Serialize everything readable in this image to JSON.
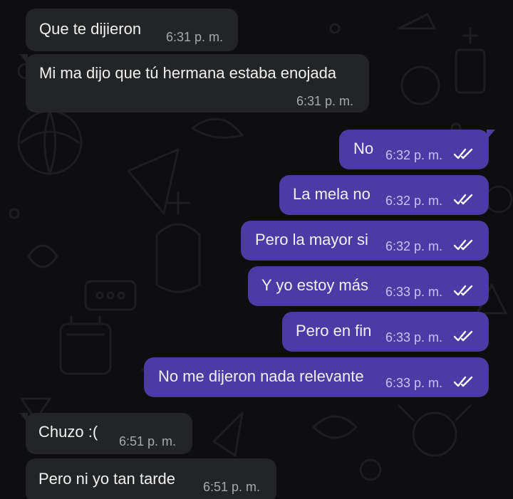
{
  "messages": [
    {
      "id": "m1",
      "direction": "in",
      "text": "Que te dijieron",
      "time": "6:31 p. m."
    },
    {
      "id": "m2",
      "direction": "in",
      "text": "Mi ma dijo que tú hermana estaba enojada",
      "time": "6:31 p. m."
    },
    {
      "id": "m3",
      "direction": "out",
      "text": "No",
      "time": "6:32 p. m.",
      "status": "read"
    },
    {
      "id": "m4",
      "direction": "out",
      "text": "La mela no",
      "time": "6:32 p. m.",
      "status": "read"
    },
    {
      "id": "m5",
      "direction": "out",
      "text": "Pero la mayor si",
      "time": "6:32 p. m.",
      "status": "read"
    },
    {
      "id": "m6",
      "direction": "out",
      "text": "Y yo estoy más",
      "time": "6:33 p. m.",
      "status": "read"
    },
    {
      "id": "m7",
      "direction": "out",
      "text": "Pero en fin",
      "time": "6:33 p. m.",
      "status": "read"
    },
    {
      "id": "m8",
      "direction": "out",
      "text": "No me dijeron nada relevante",
      "time": "6:33 p. m.",
      "status": "read"
    },
    {
      "id": "m9",
      "direction": "in",
      "text": "Chuzo :(",
      "time": "6:51 p. m."
    },
    {
      "id": "m10",
      "direction": "in",
      "text": "Pero ni yo tan tarde",
      "time": "6:51 p. m."
    }
  ],
  "colors": {
    "background": "#0e0e10",
    "incoming_bubble": "#222426",
    "outgoing_bubble": "#4c3aa5",
    "read_ticks": "#ffffff"
  },
  "icons": {
    "read_status": "double-check-icon",
    "wallpaper": "doodle-pattern"
  }
}
